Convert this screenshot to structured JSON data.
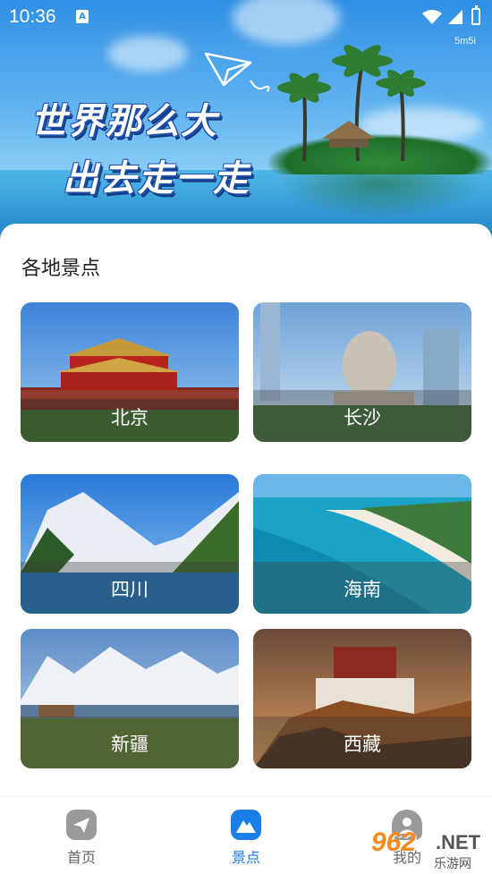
{
  "status_bar": {
    "time": "10:36",
    "speed": "5m5i"
  },
  "banner": {
    "line1": "世界那么大",
    "line2": "出去走一走"
  },
  "section": {
    "title": "各地景点"
  },
  "places": [
    {
      "name": "北京"
    },
    {
      "name": "长沙"
    },
    {
      "name": "四川"
    },
    {
      "name": "海南"
    },
    {
      "name": "新疆"
    },
    {
      "name": "西藏"
    }
  ],
  "bottom_nav": {
    "home": "首页",
    "spots": "景点",
    "mine": "我的",
    "active_color": "#1a7ee8",
    "inactive_color": "#9a9a9a"
  },
  "watermark": {
    "number": "962",
    "net": ".NET",
    "sub": "乐游网"
  }
}
